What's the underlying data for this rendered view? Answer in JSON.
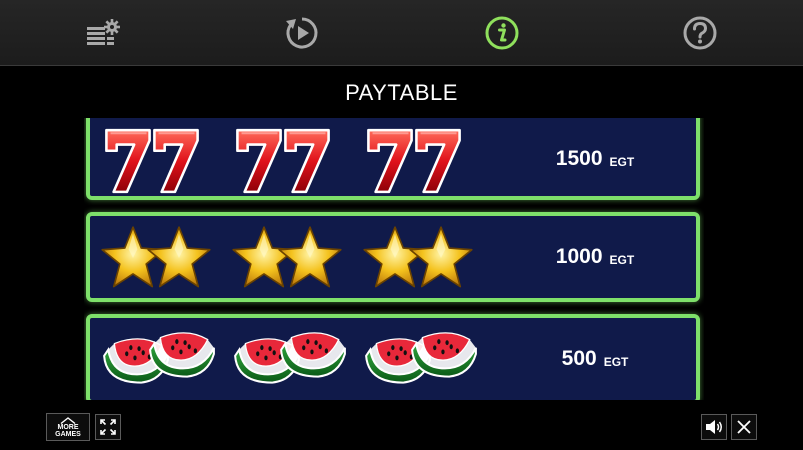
{
  "toolbar": {
    "buttons": [
      {
        "name": "paytable-settings",
        "icon": "stack-gear-icon"
      },
      {
        "name": "autoplay",
        "icon": "replay-icon"
      },
      {
        "name": "info",
        "icon": "info-icon",
        "active": true
      },
      {
        "name": "help",
        "icon": "question-icon"
      }
    ]
  },
  "colors": {
    "accent": "#7ee06a",
    "panel_bg": "#101a4a",
    "toolbar_bg": "#262626"
  },
  "paytable": {
    "title": "PAYTABLE",
    "rows": [
      {
        "symbol": "seven",
        "icon": "lucky-seven-icon",
        "count": 3,
        "amount": "1500",
        "currency": "EGT"
      },
      {
        "symbol": "star",
        "icon": "star-icon",
        "count": 3,
        "amount": "1000",
        "currency": "EGT"
      },
      {
        "symbol": "watermelon",
        "icon": "watermelon-icon",
        "count": 3,
        "amount": "500",
        "currency": "EGT"
      }
    ]
  },
  "bottom": {
    "more_games_line1": "MORE",
    "more_games_line2": "GAMES"
  }
}
